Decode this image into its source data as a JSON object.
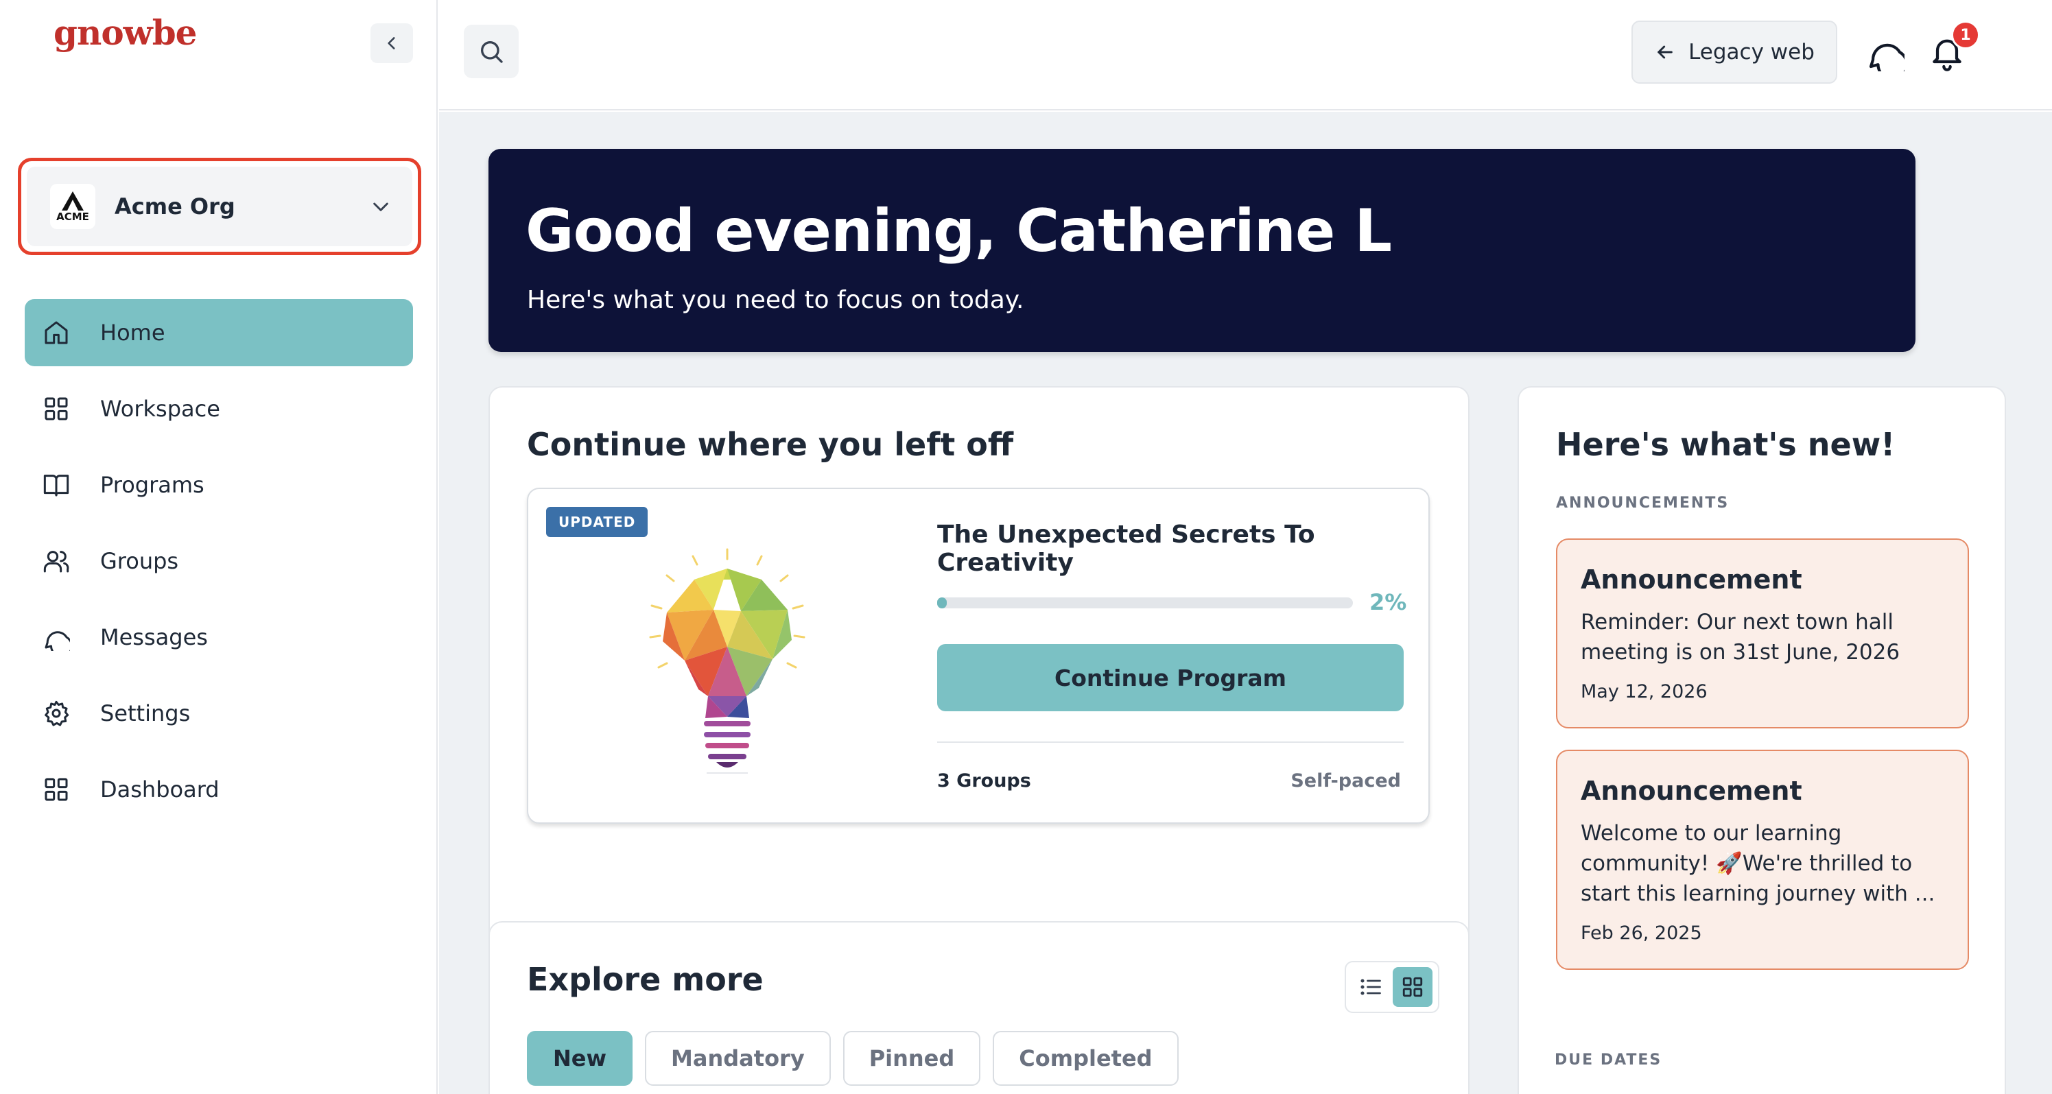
{
  "sidebar": {
    "logo": "gnowbe",
    "org": {
      "logo_text": "ACME",
      "name": "Acme Org"
    },
    "nav": [
      {
        "label": "Home",
        "icon": "home-icon",
        "active": true
      },
      {
        "label": "Workspace",
        "icon": "grid-icon",
        "active": false
      },
      {
        "label": "Programs",
        "icon": "book-icon",
        "active": false
      },
      {
        "label": "Groups",
        "icon": "users-icon",
        "active": false
      },
      {
        "label": "Messages",
        "icon": "chat-icon",
        "active": false
      },
      {
        "label": "Settings",
        "icon": "gear-icon",
        "active": false
      },
      {
        "label": "Dashboard",
        "icon": "dashboard-icon",
        "active": false
      }
    ]
  },
  "topbar": {
    "legacy_label": "Legacy web",
    "notification_count": "1"
  },
  "hero": {
    "title": "Good evening, Catherine L",
    "subtitle": "Here's what you need to focus on today."
  },
  "continue": {
    "title": "Continue where you left off",
    "program": {
      "badge": "UPDATED",
      "title": "The Unexpected Secrets To Creativity",
      "progress_percent": 2,
      "progress_label": "2%",
      "button_label": "Continue Program",
      "groups": "3 Groups",
      "pace": "Self-paced"
    }
  },
  "explore": {
    "title": "Explore more",
    "tabs": [
      {
        "label": "New",
        "active": true
      },
      {
        "label": "Mandatory",
        "active": false
      },
      {
        "label": "Pinned",
        "active": false
      },
      {
        "label": "Completed",
        "active": false
      }
    ]
  },
  "news": {
    "title": "Here's what's new!",
    "announcements_label": "ANNOUNCEMENTS",
    "announcements": [
      {
        "title": "Announcement",
        "body": "Reminder: Our next town hall meeting is on 31st June, 2026",
        "date": "May 12, 2026"
      },
      {
        "title": "Announcement",
        "body": "Welcome to our learning community! 🚀We're thrilled to start this learning journey with ...",
        "date": "Feb 26, 2025"
      }
    ],
    "due_dates_label": "DUE DATES"
  },
  "colors": {
    "brand_red": "#c0302b",
    "accent_teal": "#7bc1c4",
    "hero_navy": "#0d1238",
    "highlight_red": "#e5402c",
    "announcement_bg": "#fbeee8",
    "announcement_border": "#e58a66"
  }
}
